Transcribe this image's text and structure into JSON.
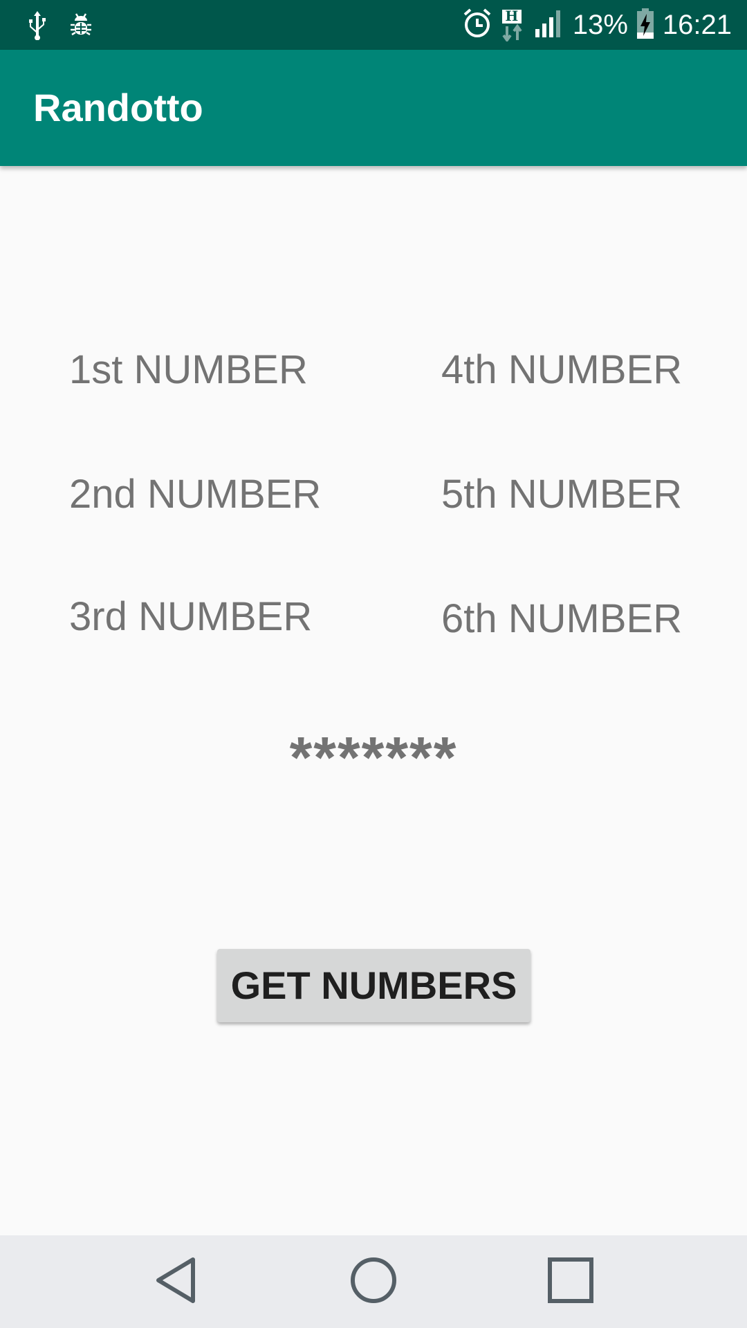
{
  "status_bar": {
    "battery_percent": "13%",
    "time": "16:21",
    "left_icons": [
      "usb-icon",
      "bug-icon"
    ],
    "right_icons": [
      "alarm-icon",
      "hspa-data-icon",
      "signal-icon",
      "battery-charging-icon"
    ],
    "data_indicator": "H"
  },
  "app_bar": {
    "title": "Randotto"
  },
  "numbers": {
    "n1": "1st NUMBER",
    "n2": "2nd NUMBER",
    "n3": "3rd NUMBER",
    "n4": "4th NUMBER",
    "n5": "5th NUMBER",
    "n6": "6th NUMBER"
  },
  "bonus": "*******",
  "get_button_label": "GET NUMBERS",
  "nav_bar": {
    "icons": [
      "back-icon",
      "home-icon",
      "recents-icon"
    ]
  },
  "colors": {
    "status_bar": "#00574b",
    "app_bar": "#008577",
    "background": "#fafafa",
    "number_text": "#737373",
    "button": "#d6d7d7",
    "nav_bar": "#eaebee"
  }
}
